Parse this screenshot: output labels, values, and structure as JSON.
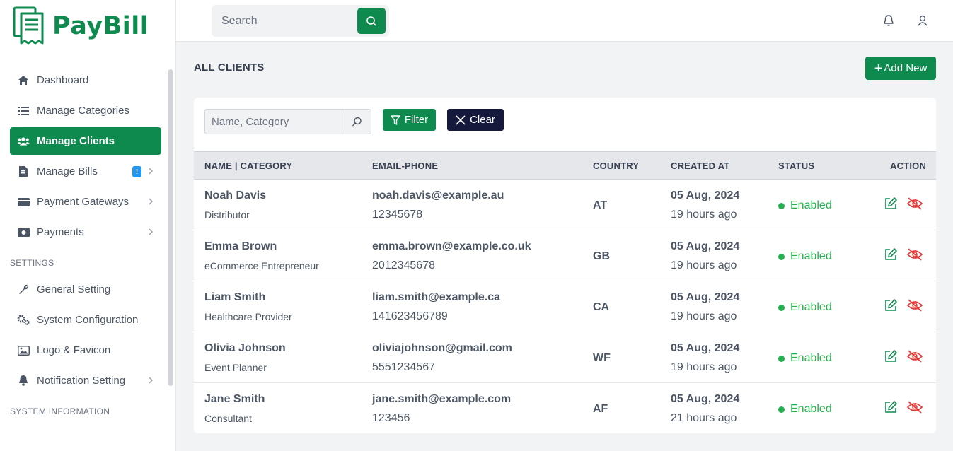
{
  "brand": {
    "name": "PayBill",
    "color": "#0f8a4f"
  },
  "sidebar": {
    "items": [
      {
        "label": "Dashboard",
        "icon": "home-icon"
      },
      {
        "label": "Manage Categories",
        "icon": "list-icon"
      },
      {
        "label": "Manage Clients",
        "icon": "users-icon",
        "active": true
      },
      {
        "label": "Manage Bills",
        "icon": "file-invoice-icon",
        "badge": "!"
      },
      {
        "label": "Payment Gateways",
        "icon": "credit-card-icon"
      },
      {
        "label": "Payments",
        "icon": "money-icon"
      }
    ],
    "settings_label": "SETTINGS",
    "settings_items": [
      {
        "label": "General Setting",
        "icon": "wrench-icon"
      },
      {
        "label": "System Configuration",
        "icon": "gears-icon"
      },
      {
        "label": "Logo & Favicon",
        "icon": "image-icon"
      },
      {
        "label": "Notification Setting",
        "icon": "bell-icon"
      }
    ],
    "system_label": "SYSTEM INFORMATION"
  },
  "topbar": {
    "search_placeholder": "Search"
  },
  "page": {
    "title": "ALL CLIENTS",
    "add_label": "Add New",
    "filter_placeholder": "Name, Category",
    "filter_label": "Filter",
    "clear_label": "Clear"
  },
  "table": {
    "headers": [
      "NAME | CATEGORY",
      "EMAIL-PHONE",
      "COUNTRY",
      "CREATED AT",
      "STATUS",
      "ACTION"
    ],
    "rows": [
      {
        "name": "Noah Davis",
        "category": "Distributor",
        "email": "noah.davis@example.au",
        "phone": "12345678",
        "country": "AT",
        "date": "05 Aug, 2024",
        "ago": "19 hours ago",
        "status": "Enabled"
      },
      {
        "name": "Emma Brown",
        "category": "eCommerce Entrepreneur",
        "email": "emma.brown@example.co.uk",
        "phone": "2012345678",
        "country": "GB",
        "date": "05 Aug, 2024",
        "ago": "19 hours ago",
        "status": "Enabled"
      },
      {
        "name": "Liam Smith",
        "category": "Healthcare Provider",
        "email": "liam.smith@example.ca",
        "phone": "141623456789",
        "country": "CA",
        "date": "05 Aug, 2024",
        "ago": "19 hours ago",
        "status": "Enabled"
      },
      {
        "name": "Olivia Johnson",
        "category": "Event Planner",
        "email": "oliviajohnson@gmail.com",
        "phone": "5551234567",
        "country": "WF",
        "date": "05 Aug, 2024",
        "ago": "19 hours ago",
        "status": "Enabled"
      },
      {
        "name": "Jane Smith",
        "category": "Consultant",
        "email": "jane.smith@example.com",
        "phone": "123456",
        "country": "AF",
        "date": "05 Aug, 2024",
        "ago": "21 hours ago",
        "status": "Enabled"
      }
    ]
  },
  "colors": {
    "primary": "#0f8a4f",
    "dark": "#151a3c",
    "enabled": "#22b14c",
    "danger": "#e53935",
    "badge": "#2196f3"
  }
}
